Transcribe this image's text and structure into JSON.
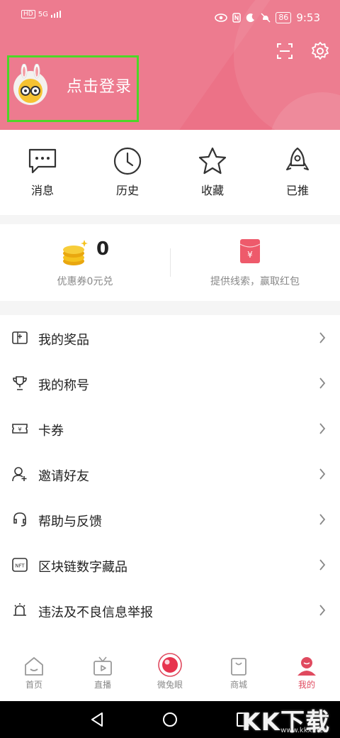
{
  "status_bar": {
    "left_badge": "HD",
    "signal": "5G",
    "battery": "86",
    "time": "9:53"
  },
  "header": {
    "login_text": "点击登录",
    "bg_color": "#ec7287",
    "icons": [
      "scan-icon",
      "settings-icon"
    ]
  },
  "quick_actions": [
    {
      "label": "消息",
      "icon": "message-icon"
    },
    {
      "label": "历史",
      "icon": "clock-icon"
    },
    {
      "label": "收藏",
      "icon": "star-icon"
    },
    {
      "label": "已推",
      "icon": "rocket-icon"
    }
  ],
  "coupon": {
    "count": "0",
    "coupon_label": "优惠券0元兑",
    "clue_label": "提供线索，赢取红包"
  },
  "menu": [
    {
      "label": "我的奖品",
      "icon": "prize-icon"
    },
    {
      "label": "我的称号",
      "icon": "trophy-icon"
    },
    {
      "label": "卡券",
      "icon": "ticket-icon"
    },
    {
      "label": "邀请好友",
      "icon": "add-user-icon"
    },
    {
      "label": "帮助与反馈",
      "icon": "headset-icon"
    },
    {
      "label": "区块链数字藏品",
      "icon": "nft-icon"
    },
    {
      "label": "违法及不良信息举报",
      "icon": "alarm-icon"
    }
  ],
  "bottom_nav": [
    {
      "label": "首页",
      "icon": "home-icon"
    },
    {
      "label": "直播",
      "icon": "tv-icon"
    },
    {
      "label": "微兔眼",
      "icon": "eye-icon"
    },
    {
      "label": "商城",
      "icon": "bag-icon"
    },
    {
      "label": "我的",
      "icon": "profile-icon",
      "active": true
    }
  ],
  "watermark": {
    "text": "KK下载",
    "url": "www.kkx.net"
  },
  "colors": {
    "accent": "#e04a5f",
    "highlight_box": "#4dd628"
  }
}
